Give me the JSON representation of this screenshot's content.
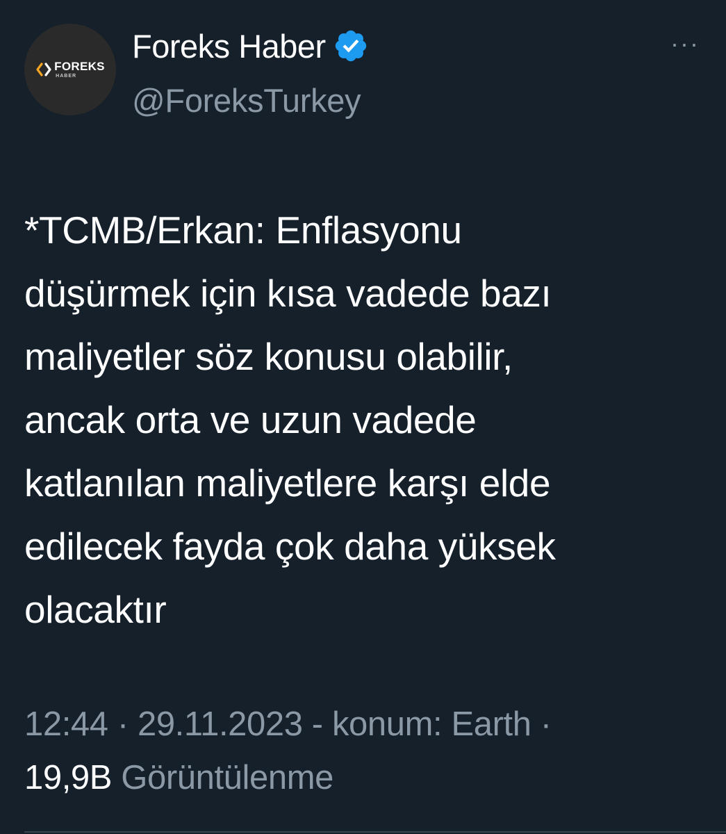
{
  "author": {
    "display_name": "Foreks Haber",
    "handle": "@ForeksTurkey",
    "verified_icon": "verified-badge-icon",
    "avatar": {
      "logo_main": "FOREKS",
      "logo_sub": "HABER",
      "logo_icon": "chevron-brackets-icon"
    }
  },
  "menu": {
    "more_label": "···"
  },
  "tweet": {
    "lines": [
      "*TCMB/Erkan: Enflasyonu",
      "düşürmek için kısa vadede bazı",
      "maliyetler söz konusu olabilir,",
      "ancak orta ve uzun vadede",
      "katlanılan maliyetlere karşı elde",
      "edilecek fayda çok daha yüksek",
      "olacaktır"
    ]
  },
  "meta": {
    "time": "12:44",
    "separator": " · ",
    "date": "29.11.2023",
    "location": " - konum: Earth ·",
    "views_count": "19,9B",
    "views_label": " Görüntülenme"
  },
  "colors": {
    "background": "#15202b",
    "primary_text": "#ffffff",
    "secondary_text": "#8b98a5",
    "verified": "#1d9bf0",
    "logo_accent": "#f5a623"
  }
}
